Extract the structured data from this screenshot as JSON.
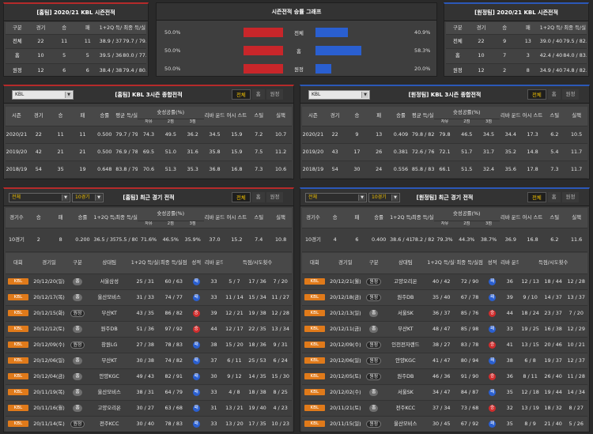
{
  "colors": {
    "home": "#c8262a",
    "away": "#2a5fd0",
    "badge": "#e07a1a",
    "highlight": "#f0c000"
  },
  "season_home": {
    "title": "[홈팀] 2020/21 KBL 시즌전적",
    "headers": [
      "구분",
      "경기",
      "승",
      "패",
      "1+2Q 득/실",
      "최종 득/실"
    ],
    "rows": [
      [
        "전체",
        "22",
        "11",
        "11",
        "38.9 / 37.5",
        "79.7 / 79.3"
      ],
      [
        "홈",
        "10",
        "5",
        "5",
        "39.5 / 36.3",
        "80.0 / 77.4"
      ],
      [
        "원정",
        "12",
        "6",
        "6",
        "38.4 / 38.4",
        "79.4 / 80.9"
      ]
    ]
  },
  "season_away": {
    "title": "[원정팀] 2020/21 KBL 시즌전적",
    "headers": [
      "구분",
      "경기",
      "승",
      "패",
      "1+2Q 득/실",
      "최종 득/실"
    ],
    "rows": [
      [
        "전체",
        "22",
        "9",
        "13",
        "39.0 / 40.7",
        "79.5 / 82.7"
      ],
      [
        "홈",
        "10",
        "7",
        "3",
        "42.4 / 40.7",
        "84.0 / 83.2"
      ],
      [
        "원정",
        "12",
        "2",
        "8",
        "34.9 / 40.7",
        "74.8 / 82.5"
      ]
    ]
  },
  "graph": {
    "title": "시즌전적 승률 그래프",
    "rows": [
      {
        "label": "전체",
        "left": "50.0%",
        "right": "40.9%",
        "l": 0.5,
        "r": 0.409
      },
      {
        "label": "홈",
        "left": "50.0%",
        "right": "58.3%",
        "l": 0.5,
        "r": 0.583
      },
      {
        "label": "원정",
        "left": "50.0%",
        "right": "20.0%",
        "l": 0.5,
        "r": 0.2
      }
    ]
  },
  "tabs": [
    "전체",
    "홈",
    "원정"
  ],
  "league": "KBL",
  "filter": {
    "scope": "전체",
    "count": "10경기"
  },
  "s3_home": {
    "title": "[홈팀] KBL 3시즌 종합전적",
    "h": [
      "시즌",
      "경기",
      "승",
      "패",
      "승률",
      "평균 득/실",
      "슛성공률(%)",
      "리바 운드",
      "어시 스트",
      "스틸",
      "실책"
    ],
    "sub": [
      "자유",
      "2점",
      "3점"
    ],
    "rows": [
      [
        "2020/21",
        "22",
        "11",
        "11",
        "0.500",
        "79.7 / 79.3",
        "74.3",
        "49.5",
        "36.2",
        "34.5",
        "15.9",
        "7.2",
        "10.7"
      ],
      [
        "2019/20",
        "42",
        "21",
        "21",
        "0.500",
        "76.9 / 78.2",
        "69.5",
        "51.0",
        "31.6",
        "35.8",
        "15.9",
        "7.5",
        "11.2"
      ],
      [
        "2018/19",
        "54",
        "35",
        "19",
        "0.648",
        "83.8 / 79.9",
        "70.6",
        "51.3",
        "35.3",
        "36.8",
        "16.8",
        "7.3",
        "10.6"
      ]
    ]
  },
  "s3_away": {
    "title": "[원정팀] KBL 3시즌 종합전적",
    "h": [
      "시즌",
      "경기",
      "승",
      "패",
      "승률",
      "평균 득/실",
      "슛성공률(%)",
      "리바 운드",
      "어시 스트",
      "스틸",
      "실책"
    ],
    "sub": [
      "자유",
      "2점",
      "3점"
    ],
    "rows": [
      [
        "2020/21",
        "22",
        "9",
        "13",
        "0.409",
        "79.8 / 82.7",
        "79.8",
        "46.5",
        "34.5",
        "34.4",
        "17.3",
        "6.2",
        "10.5"
      ],
      [
        "2019/20",
        "43",
        "17",
        "26",
        "0.381",
        "72.6 / 76.0",
        "72.1",
        "51.7",
        "31.7",
        "35.2",
        "14.8",
        "5.4",
        "11.7"
      ],
      [
        "2018/19",
        "54",
        "30",
        "24",
        "0.556",
        "85.8 / 83.2",
        "66.1",
        "51.5",
        "32.4",
        "35.6",
        "17.8",
        "7.3",
        "11.7"
      ]
    ]
  },
  "rec_home": {
    "title": "[홈팀] 최근 경기 전적",
    "sh": [
      "경기수",
      "승",
      "패",
      "승률",
      "1+2Q 득/실점",
      "최종 득/실점",
      "슛성공률(%)",
      "리바 운드",
      "어시 스트",
      "스틸",
      "실책"
    ],
    "ssub": [
      "자유",
      "2점",
      "3점"
    ],
    "srow": [
      "10경기",
      "2",
      "8",
      "0.200",
      "36.5 / 35.2",
      "75.5 / 80.0",
      "71.6%",
      "46.5%",
      "35.9%",
      "37.0",
      "15.2",
      "7.4",
      "10.8"
    ],
    "gh": [
      "대회",
      "경기일",
      "구분",
      "상대팀",
      "1+2Q 득/실점",
      "최종 득/실점",
      "성적",
      "리바 운드",
      "득점/시도횟수"
    ],
    "games": [
      [
        "KBL",
        "20/12/20(일)",
        "홈",
        "서울삼성",
        "25 / 31",
        "60 / 63",
        "패",
        "33",
        "5 / 7",
        "17 / 36",
        "7 / 20"
      ],
      [
        "KBL",
        "20/12/17(목)",
        "홈",
        "울산모비스",
        "31 / 33",
        "74 / 77",
        "패",
        "33",
        "11 / 14",
        "15 / 34",
        "11 / 27"
      ],
      [
        "KBL",
        "20/12/15(화)",
        "원정",
        "부산KT",
        "43 / 35",
        "86 / 82",
        "승",
        "39",
        "12 / 21",
        "19 / 38",
        "12 / 28"
      ],
      [
        "KBL",
        "20/12/12(토)",
        "홈",
        "원주DB",
        "51 / 36",
        "97 / 92",
        "승",
        "44",
        "12 / 17",
        "22 / 35",
        "13 / 34"
      ],
      [
        "KBL",
        "20/12/09(수)",
        "원정",
        "창원LG",
        "27 / 38",
        "78 / 83",
        "패",
        "38",
        "15 / 20",
        "18 / 36",
        "9 / 31"
      ],
      [
        "KBL",
        "20/12/06(일)",
        "홈",
        "부산KT",
        "30 / 38",
        "74 / 82",
        "패",
        "37",
        "6 / 11",
        "25 / 53",
        "6 / 24"
      ],
      [
        "KBL",
        "20/12/04(금)",
        "홈",
        "안양KGC",
        "49 / 43",
        "82 / 91",
        "패",
        "30",
        "9 / 12",
        "14 / 35",
        "15 / 30"
      ],
      [
        "KBL",
        "20/11/19(목)",
        "홈",
        "울산모비스",
        "38 / 31",
        "64 / 79",
        "패",
        "33",
        "4 / 8",
        "18 / 38",
        "8 / 25"
      ],
      [
        "KBL",
        "20/11/16(월)",
        "홈",
        "고양오리온",
        "30 / 27",
        "63 / 68",
        "패",
        "31",
        "13 / 21",
        "19 / 40",
        "4 / 23"
      ],
      [
        "KBL",
        "20/11/14(토)",
        "원정",
        "전주KCC",
        "30 / 40",
        "78 / 83",
        "패",
        "33",
        "13 / 20",
        "17 / 35",
        "10 / 23"
      ]
    ]
  },
  "rec_away": {
    "title": "[원정팀] 최근 경기 전적",
    "sh": [
      "경기수",
      "승",
      "패",
      "승률",
      "1+2Q 득/실점",
      "최종 득/실점",
      "슛성공률(%)",
      "리바 운드",
      "어시 스트",
      "스틸",
      "실책"
    ],
    "ssub": [
      "자유",
      "2점",
      "3점"
    ],
    "srow": [
      "10경기",
      "4",
      "6",
      "0.400",
      "38.6 / 41.4",
      "78.2 / 82.8",
      "79.3%",
      "44.3%",
      "38.7%",
      "36.9",
      "16.8",
      "6.2",
      "11.6"
    ],
    "gh": [
      "대회",
      "경기일",
      "구분",
      "상대팀",
      "1+2Q 득/실점",
      "최종 득/실점",
      "성적",
      "리바 운드",
      "득점/시도횟수"
    ],
    "games": [
      [
        "KBL",
        "20/12/21(월)",
        "원정",
        "고양오리온",
        "40 / 42",
        "72 / 90",
        "패",
        "36",
        "12 / 13",
        "18 / 44",
        "12 / 28"
      ],
      [
        "KBL",
        "20/12/18(금)",
        "원정",
        "원주DB",
        "35 / 40",
        "67 / 78",
        "패",
        "39",
        "9 / 10",
        "14 / 37",
        "13 / 37"
      ],
      [
        "KBL",
        "20/12/13(일)",
        "홈",
        "서울SK",
        "36 / 37",
        "85 / 76",
        "승",
        "44",
        "18 / 24",
        "23 / 37",
        "7 / 20"
      ],
      [
        "KBL",
        "20/12/11(금)",
        "홈",
        "부산KT",
        "48 / 47",
        "85 / 98",
        "패",
        "33",
        "19 / 25",
        "16 / 38",
        "12 / 29"
      ],
      [
        "KBL",
        "20/12/09(수)",
        "원정",
        "인천전자랜드",
        "38 / 27",
        "83 / 78",
        "승",
        "41",
        "13 / 15",
        "20 / 46",
        "10 / 21"
      ],
      [
        "KBL",
        "20/12/06(일)",
        "원정",
        "안양KGC",
        "41 / 47",
        "80 / 94",
        "패",
        "38",
        "6 / 8",
        "19 / 37",
        "12 / 37"
      ],
      [
        "KBL",
        "20/12/05(토)",
        "원정",
        "원주DB",
        "46 / 36",
        "91 / 90",
        "승",
        "36",
        "8 / 11",
        "26 / 40",
        "11 / 28"
      ],
      [
        "KBL",
        "20/12/02(수)",
        "홈",
        "서울SK",
        "34 / 47",
        "84 / 87",
        "패",
        "35",
        "12 / 18",
        "19 / 44",
        "14 / 34"
      ],
      [
        "KBL",
        "20/11/21(토)",
        "홈",
        "전주KCC",
        "37 / 34",
        "73 / 68",
        "승",
        "32",
        "13 / 19",
        "18 / 32",
        "8 / 27"
      ],
      [
        "KBL",
        "20/11/15(일)",
        "원정",
        "울산모비스",
        "30 / 45",
        "67 / 92",
        "패",
        "35",
        "8 / 9",
        "21 / 40",
        "5 / 26"
      ]
    ]
  }
}
